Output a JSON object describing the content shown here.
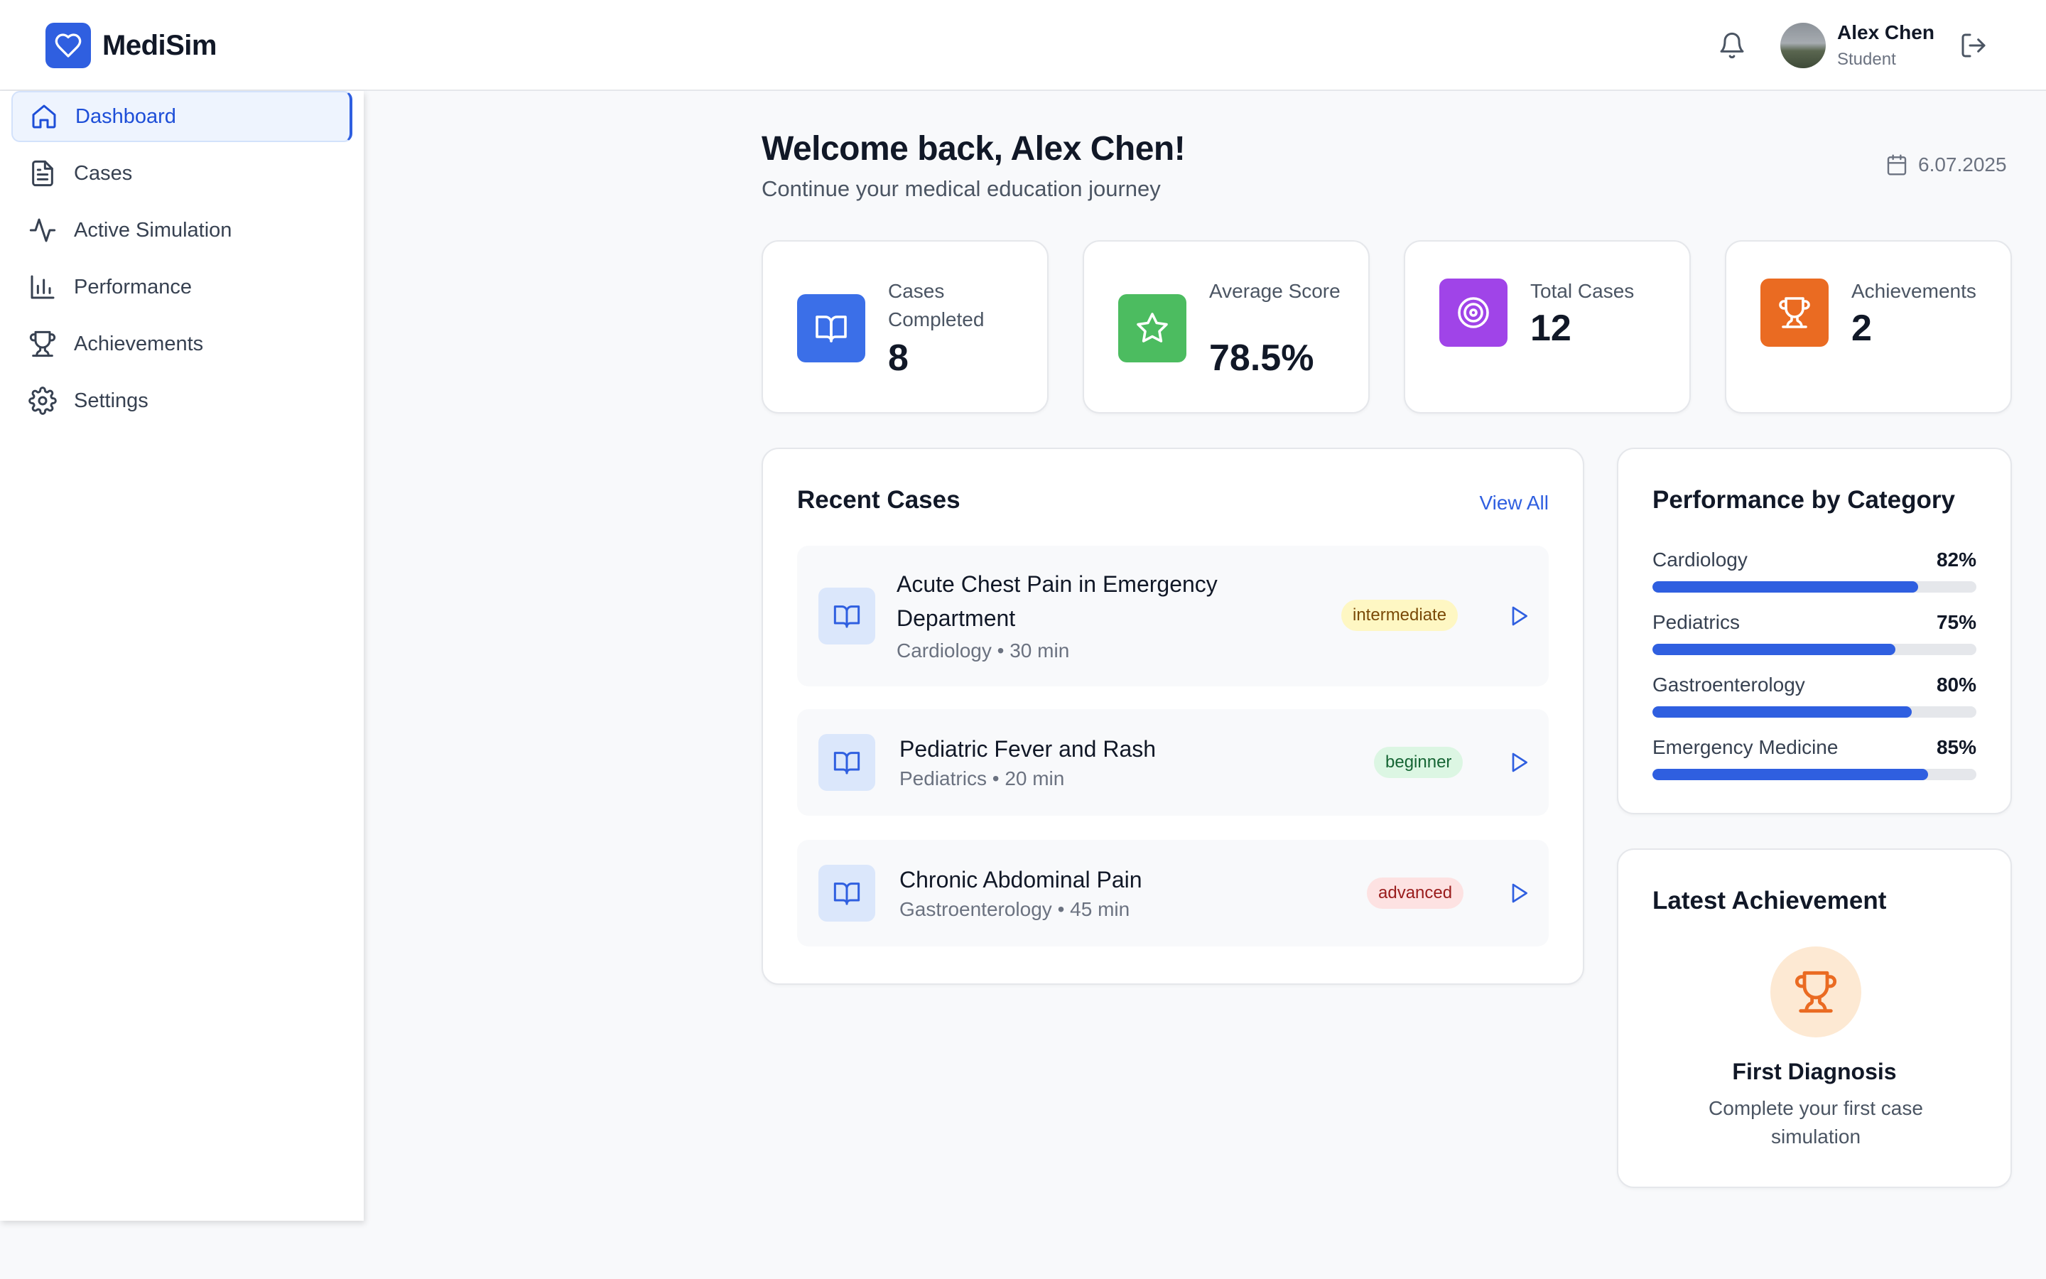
{
  "app": {
    "name": "MediSim"
  },
  "header": {
    "user": {
      "name": "Alex Chen",
      "role": "Student"
    }
  },
  "sidebar": {
    "items": [
      {
        "label": "Dashboard",
        "icon": "home-icon",
        "active": true
      },
      {
        "label": "Cases",
        "icon": "document-icon",
        "active": false
      },
      {
        "label": "Active Simulation",
        "icon": "activity-icon",
        "active": false
      },
      {
        "label": "Performance",
        "icon": "bar-chart-icon",
        "active": false
      },
      {
        "label": "Achievements",
        "icon": "trophy-icon",
        "active": false
      },
      {
        "label": "Settings",
        "icon": "gear-icon",
        "active": false
      }
    ]
  },
  "welcome": {
    "title": "Welcome back, Alex Chen!",
    "subtitle": "Continue your medical education journey",
    "date": "6.07.2025"
  },
  "stats": [
    {
      "label": "Cases Completed",
      "value": "8",
      "icon": "book-icon",
      "color": "#3b6fe8"
    },
    {
      "label": "Average Score",
      "value": "78.5%",
      "icon": "star-icon",
      "color": "#4cbc60"
    },
    {
      "label": "Total Cases",
      "value": "12",
      "icon": "target-icon",
      "color": "#a044e8"
    },
    {
      "label": "Achievements",
      "value": "2",
      "icon": "trophy-icon",
      "color": "#ea6b22"
    }
  ],
  "recent_cases": {
    "title": "Recent Cases",
    "view_all": "View All",
    "items": [
      {
        "title": "Acute Chest Pain in Emergency Department",
        "category": "Cardiology",
        "duration": "30 min",
        "level": "intermediate"
      },
      {
        "title": "Pediatric Fever and Rash",
        "category": "Pediatrics",
        "duration": "20 min",
        "level": "beginner"
      },
      {
        "title": "Chronic Abdominal Pain",
        "category": "Gastroenterology",
        "duration": "45 min",
        "level": "advanced"
      }
    ]
  },
  "performance": {
    "title": "Performance by Category",
    "categories": [
      {
        "name": "Cardiology",
        "percent_label": "82%",
        "value": 82
      },
      {
        "name": "Pediatrics",
        "percent_label": "75%",
        "value": 75
      },
      {
        "name": "Gastroenterology",
        "percent_label": "80%",
        "value": 80
      },
      {
        "name": "Emergency Medicine",
        "percent_label": "85%",
        "value": 85
      }
    ]
  },
  "latest_achievement": {
    "title": "Latest Achievement",
    "name": "First Diagnosis",
    "description": "Complete your first case simulation"
  },
  "colors": {
    "primary": "#2f5fe0",
    "accent_orange": "#ea6b22"
  }
}
